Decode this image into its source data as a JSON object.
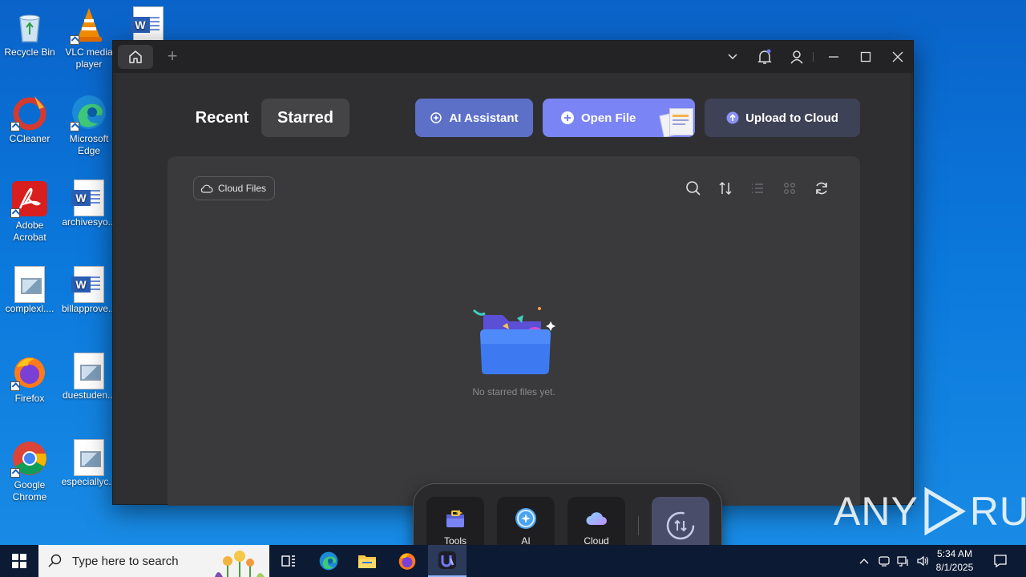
{
  "desktop": {
    "icons": [
      {
        "label": "Recycle Bin",
        "icon": "recycle-bin-icon"
      },
      {
        "label": "VLC media\nplayer",
        "icon": "vlc-icon"
      },
      {
        "label": "",
        "icon": "word-document-icon"
      },
      {
        "label": "CCleaner",
        "icon": "ccleaner-icon"
      },
      {
        "label": "Microsoft\nEdge",
        "icon": "edge-icon"
      },
      {
        "label": "Adobe\nAcrobat",
        "icon": "acrobat-icon"
      },
      {
        "label": "archivesyo...",
        "icon": "word-document-icon"
      },
      {
        "label": "complexl....",
        "icon": "image-document-icon"
      },
      {
        "label": "billapprove...",
        "icon": "word-document-icon"
      },
      {
        "label": "Firefox",
        "icon": "firefox-icon"
      },
      {
        "label": "duestuden...",
        "icon": "image-document-icon"
      },
      {
        "label": "Google\nChrome",
        "icon": "chrome-icon"
      },
      {
        "label": "especiallyc...",
        "icon": "image-document-icon"
      }
    ]
  },
  "app": {
    "tabs": {
      "recent": "Recent",
      "starred": "Starred"
    },
    "actions": {
      "ai_assistant": "AI Assistant",
      "open_file": "Open File",
      "upload_to_cloud": "Upload to Cloud"
    },
    "filter_chip": "Cloud Files",
    "empty_message": "No starred files yet.",
    "dock": {
      "tools": "Tools",
      "ai": "AI",
      "cloud": "Cloud"
    },
    "colors": {
      "ai_assistant_bg": "#5d70c8",
      "open_file_bg": "#7b84f4",
      "upload_bg": "#3e4256"
    }
  },
  "watermark": {
    "left": "ANY",
    "right": "RUN"
  },
  "taskbar": {
    "search_placeholder": "Type here to search",
    "time": "5:34 AM",
    "date": "8/1/2025"
  }
}
